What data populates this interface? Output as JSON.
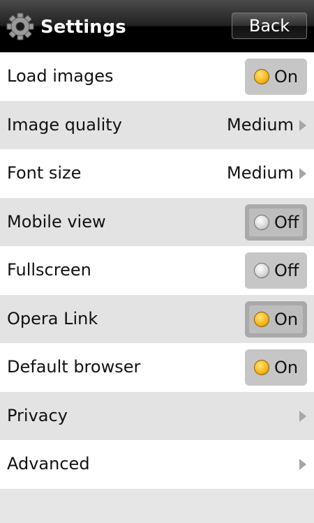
{
  "header": {
    "title": "Settings",
    "back_label": "Back",
    "icon": "gear-icon"
  },
  "settings": {
    "load_images": {
      "label": "Load images",
      "state": "On",
      "enabled": true
    },
    "image_quality": {
      "label": "Image quality",
      "value": "Medium"
    },
    "font_size": {
      "label": "Font size",
      "value": "Medium"
    },
    "mobile_view": {
      "label": "Mobile view",
      "state": "Off",
      "enabled": false
    },
    "fullscreen": {
      "label": "Fullscreen",
      "state": "Off",
      "enabled": false
    },
    "opera_link": {
      "label": "Opera Link",
      "state": "On",
      "enabled": true
    },
    "default_browser": {
      "label": "Default browser",
      "state": "On",
      "enabled": true
    },
    "privacy": {
      "label": "Privacy"
    },
    "advanced": {
      "label": "Advanced"
    }
  },
  "colors": {
    "header_bg": "#000000",
    "row_white": "#ffffff",
    "row_gray": "#e3e3e3",
    "toggle_on_dot": "#f8b81c",
    "toggle_off_dot": "#d8d8d8"
  }
}
